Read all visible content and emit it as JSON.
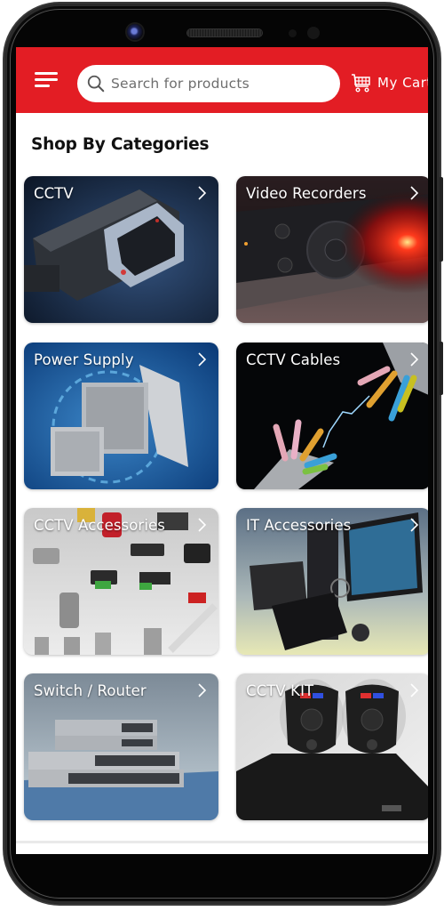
{
  "header": {
    "search_placeholder": "Search for products",
    "cart_label": "My Cart",
    "brand_color": "#e31d24"
  },
  "section": {
    "title": "Shop By Categories"
  },
  "categories": [
    {
      "label": "CCTV",
      "icon": "security-camera-image"
    },
    {
      "label": "Video Recorders",
      "icon": "dvr-image"
    },
    {
      "label": "Power Supply",
      "icon": "power-supply-image"
    },
    {
      "label": "CCTV Cables",
      "icon": "cables-image"
    },
    {
      "label": "CCTV Accessories",
      "icon": "connectors-image"
    },
    {
      "label": "IT Accessories",
      "icon": "computer-image"
    },
    {
      "label": "Switch / Router",
      "icon": "network-switch-image"
    },
    {
      "label": "CCTV KIT",
      "icon": "camera-kit-image"
    }
  ]
}
